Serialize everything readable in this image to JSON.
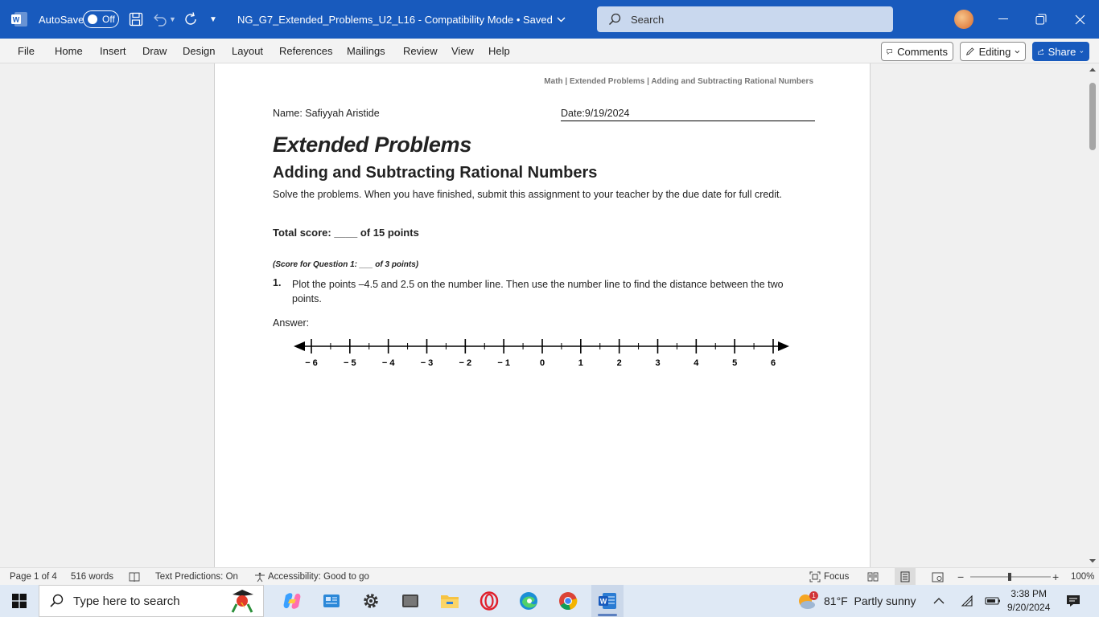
{
  "titlebar": {
    "autosave_label": "AutoSave",
    "autosave_state": "Off",
    "doc_title": "NG_G7_Extended_Problems_U2_L16  -  Compatibility Mode • Saved",
    "search_placeholder": "Search",
    "accent": "#185abd"
  },
  "ribbon": {
    "menu": [
      "File",
      "Home",
      "Insert",
      "Draw",
      "Design",
      "Layout",
      "References",
      "Mailings",
      "Review",
      "View",
      "Help"
    ],
    "comments_label": "Comments",
    "editing_label": "Editing",
    "share_label": "Share"
  },
  "document": {
    "header": "Math | Extended Problems | Adding and Subtracting Rational Numbers",
    "name": "Name: Safiyyah Aristide",
    "date": "Date:9/19/2024",
    "title": "Extended Problems",
    "subtitle": "Adding and Subtracting Rational Numbers",
    "instructions": "Solve the problems. When you have finished, submit this assignment to your teacher by the due date for full credit.",
    "total_score": "Total score: ____ of 15 points",
    "q1_score": "(Score for Question 1: ___ of 3 points)",
    "q1_number": "1.",
    "q1_text": "Plot the points  –4.5  and 2.5 on the number line. Then use the number line to find the distance between the two points.",
    "answer_label": "Answer:",
    "number_line": {
      "min": -6,
      "max": 6,
      "labels": [
        "− 6",
        "− 5",
        "− 4",
        "− 3",
        "− 2",
        "− 1",
        "0",
        "1",
        "2",
        "3",
        "4",
        "5",
        "6"
      ]
    }
  },
  "statusbar": {
    "page": "Page 1 of 4",
    "words": "516 words",
    "predictions": "Text Predictions: On",
    "accessibility": "Accessibility: Good to go",
    "focus": "Focus",
    "zoom": "100%"
  },
  "taskbar": {
    "search_placeholder": "Type here to search",
    "weather": "81°F  Partly sunny",
    "weather_badge": "1",
    "time": "3:38 PM",
    "date": "9/20/2024"
  }
}
